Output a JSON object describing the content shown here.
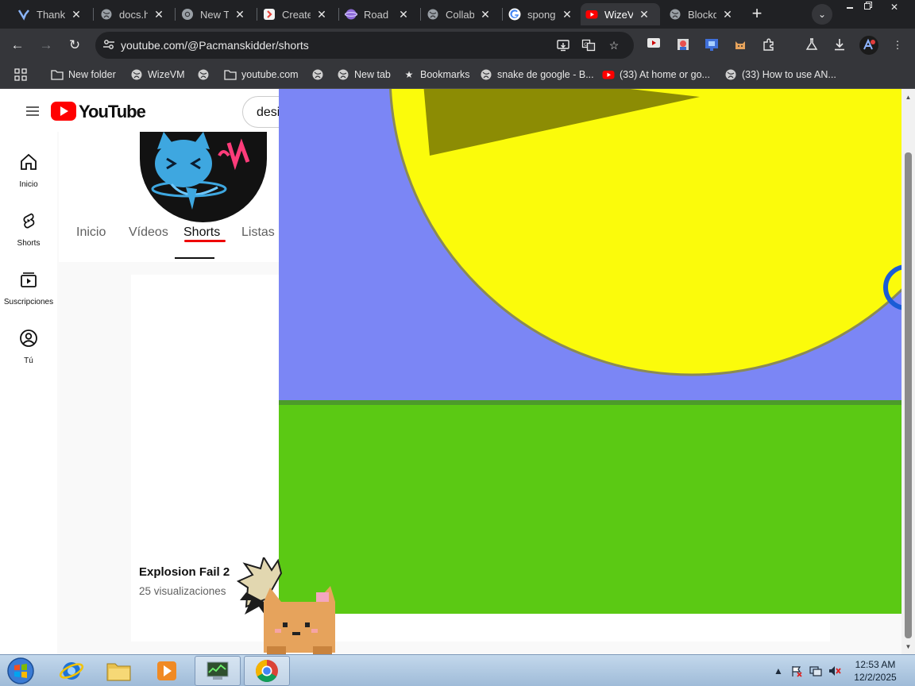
{
  "tabs": [
    {
      "title": "Thank",
      "icon": "wizevm-icon"
    },
    {
      "title": "docs.h",
      "icon": "globe-icon"
    },
    {
      "title": "New T",
      "icon": "chrome-icon"
    },
    {
      "title": "Create",
      "icon": "create-icon"
    },
    {
      "title": "Road",
      "icon": "planet-icon"
    },
    {
      "title": "Collab",
      "icon": "globe-icon"
    },
    {
      "title": "spong",
      "icon": "google-icon"
    },
    {
      "title": "WizeV",
      "icon": "youtube-icon",
      "active": true
    },
    {
      "title": "Blockd",
      "icon": "globe-icon"
    }
  ],
  "toolbar": {
    "url": "youtube.com/@Pacmanskidder/shorts"
  },
  "bookmarks": [
    {
      "label": "New folder",
      "icon": "folder-icon"
    },
    {
      "label": "WizeVM",
      "icon": "globe-icon"
    },
    {
      "label": "",
      "icon": "globe-icon"
    },
    {
      "label": "youtube.com",
      "icon": "folder-icon"
    },
    {
      "label": "",
      "icon": "globe-icon"
    },
    {
      "label": "New tab",
      "icon": "globe-icon"
    },
    {
      "label": "Bookmarks",
      "icon": "star-icon"
    },
    {
      "label": "snake de google - B...",
      "icon": "globe-icon"
    },
    {
      "label": "(33) At home or go...",
      "icon": "youtube-icon"
    },
    {
      "label": "(33) How to use AN...",
      "icon": "globe-icon"
    }
  ],
  "youtube": {
    "logo_text": "YouTube",
    "search_value": "desi",
    "guide": [
      {
        "label": "Inicio",
        "icon": "home-icon"
      },
      {
        "label": "Shorts",
        "icon": "shorts-icon"
      },
      {
        "label": "Suscripciones",
        "icon": "subscriptions-icon"
      },
      {
        "label": "Tú",
        "icon": "account-icon"
      }
    ],
    "channel_tabs": [
      {
        "label": "Inicio"
      },
      {
        "label": "Vídeos"
      },
      {
        "label": "Shorts",
        "active": true
      },
      {
        "label": "Listas"
      }
    ],
    "short": {
      "title": "Explosion Fail 2",
      "views": "25 visualizaciones"
    }
  },
  "taskbar": {
    "time": "12:53 AM",
    "date": "12/2/2025"
  },
  "colors": {
    "video_sky": "#7b86f5",
    "video_grass": "#5bc914",
    "pacman_yellow": "#fbfb0b",
    "youtube_red": "#ff0000"
  }
}
